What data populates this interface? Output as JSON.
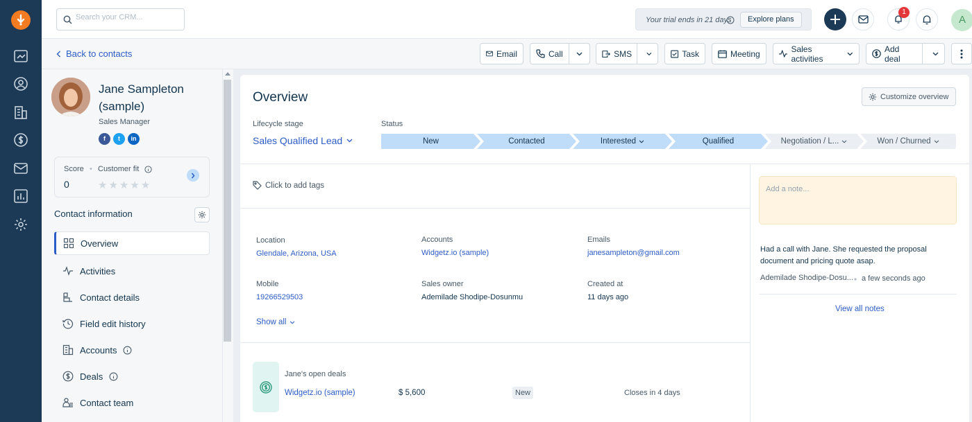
{
  "search": {
    "placeholder": "Search your CRM..."
  },
  "trial": {
    "text": "Your trial ends in 21 days",
    "button": "Explore plans"
  },
  "notifications": {
    "count": "1"
  },
  "user": {
    "initial": "A"
  },
  "nav": {
    "back_label": "Back to contacts"
  },
  "toolbar": {
    "email": "Email",
    "call": "Call",
    "sms": "SMS",
    "task": "Task",
    "meeting": "Meeting",
    "sales_activities": "Sales activities",
    "add_deal": "Add deal"
  },
  "contact": {
    "name": "Jane Sampleton (sample)",
    "title": "Sales Manager",
    "social": [
      "f",
      "t",
      "in"
    ],
    "score_label": "Score",
    "score": "0",
    "fit_label": "Customer fit",
    "fit_stars": 0
  },
  "contact_info": {
    "heading": "Contact information",
    "items": [
      {
        "label": "Overview",
        "icon": "grid-icon"
      },
      {
        "label": "Activities",
        "icon": "activity-icon"
      },
      {
        "label": "Contact details",
        "icon": "details-icon"
      },
      {
        "label": "Field edit history",
        "icon": "history-icon"
      },
      {
        "label": "Accounts",
        "icon": "building-icon"
      },
      {
        "label": "Deals",
        "icon": "dollar-icon"
      },
      {
        "label": "Contact team",
        "icon": "team-icon"
      }
    ]
  },
  "overview": {
    "title": "Overview",
    "customize": "Customize overview",
    "lifecycle_label": "Lifecycle stage",
    "lifecycle_value": "Sales Qualified Lead",
    "status_label": "Status",
    "stages": [
      "New",
      "Contacted",
      "Interested",
      "Qualified",
      "Negotiation / L...",
      "Won / Churned"
    ],
    "tags_placeholder": "Click to add tags",
    "fields": {
      "location_label": "Location",
      "location": "Glendale, Arizona, USA",
      "accounts_label": "Accounts",
      "accounts": "Widgetz.io (sample)",
      "emails_label": "Emails",
      "emails": "janesampleton@gmail.com",
      "mobile_label": "Mobile",
      "mobile": "19266529503",
      "owner_label": "Sales owner",
      "owner": "Ademilade Shodipe-Dosunmu",
      "created_label": "Created at",
      "created": "11 days ago"
    },
    "show_all": "Show all",
    "deals": {
      "heading": "Jane's open deals",
      "name": "Widgetz.io (sample)",
      "amount": "$ 5,600",
      "stage": "New",
      "closes": "Closes in 4 days"
    }
  },
  "notes": {
    "placeholder": "Add a note...",
    "text": "Had a call with Jane. She requested the proposal document and pricing quote asap.",
    "author": "Ademilade Shodipe-Dosu...",
    "time": "a few seconds ago",
    "view_all": "View all notes"
  },
  "colors": {
    "rail": "#1c3a55",
    "accent": "#2c5cc5",
    "stage_done": "#bfdcf9",
    "stage_todo": "#ebeff3",
    "note_bg": "#fef4e1"
  }
}
